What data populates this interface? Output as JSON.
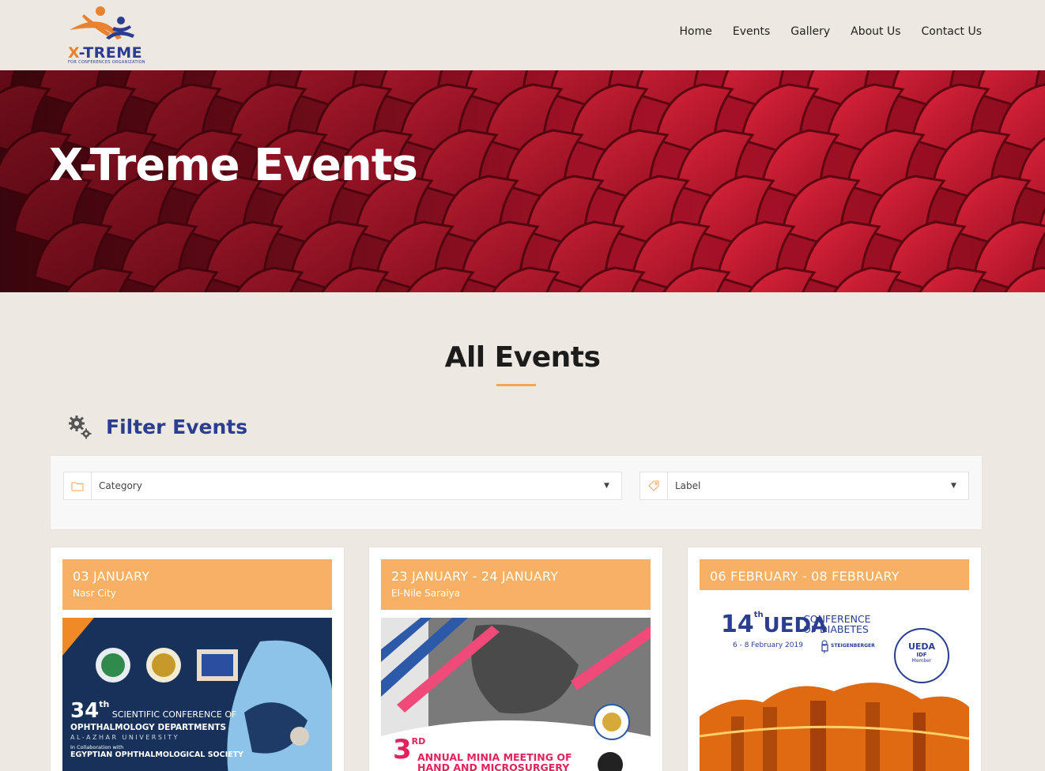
{
  "header": {
    "logo": {
      "brand_x": "X",
      "brand_rest": "-TREME",
      "tagline": "FOR CONFERENCES ORGANIZATION"
    },
    "nav": [
      {
        "label": "Home"
      },
      {
        "label": "Events"
      },
      {
        "label": "Gallery"
      },
      {
        "label": "About Us"
      },
      {
        "label": "Contact Us"
      }
    ]
  },
  "hero": {
    "title": "X-Treme Events"
  },
  "main": {
    "section_title": "All Events",
    "filter": {
      "title": "Filter Events",
      "category_selected": "Category",
      "label_selected": "Label"
    },
    "events": [
      {
        "date": "03 JANUARY",
        "location": "Nasr City",
        "poster": {
          "heading_num": "34",
          "heading_sup": "th",
          "heading_rest": "SCIENTIFIC CONFERENCE OF",
          "line2": "OPHTHALMOLOGY DEPARTMENTS",
          "line3": "AL-AZHAR UNIVERSITY",
          "line4": "In Collaboration with",
          "line5": "EGYPTIAN OPHTHALMOLOGICAL SOCIETY"
        }
      },
      {
        "date": "23 JANUARY - 24 JANUARY",
        "location": "El-Nile Saraiya",
        "poster": {
          "heading_num": "3",
          "heading_sup": "RD",
          "line1": "ANNUAL MINIA MEETING OF",
          "line2": "HAND AND MICROSURGERY"
        }
      },
      {
        "date": "06 FEBRUARY - 08 FEBRUARY",
        "location": "",
        "poster": {
          "heading_num": "14",
          "heading_sup": "th",
          "heading_name": "UEDA",
          "heading_conf1": "CONFERENCE",
          "heading_conf2": "OF DIABETES",
          "dates": "6 - 8 February 2019",
          "venue": "STEIGENBERGER",
          "badge1": "UEDA",
          "badge2": "IDF",
          "badge3": "Member"
        }
      }
    ]
  },
  "colors": {
    "accent": "#f8b065",
    "brand_blue": "#2a3d8f",
    "brand_orange": "#e8822f",
    "background": "#ede8e2"
  }
}
